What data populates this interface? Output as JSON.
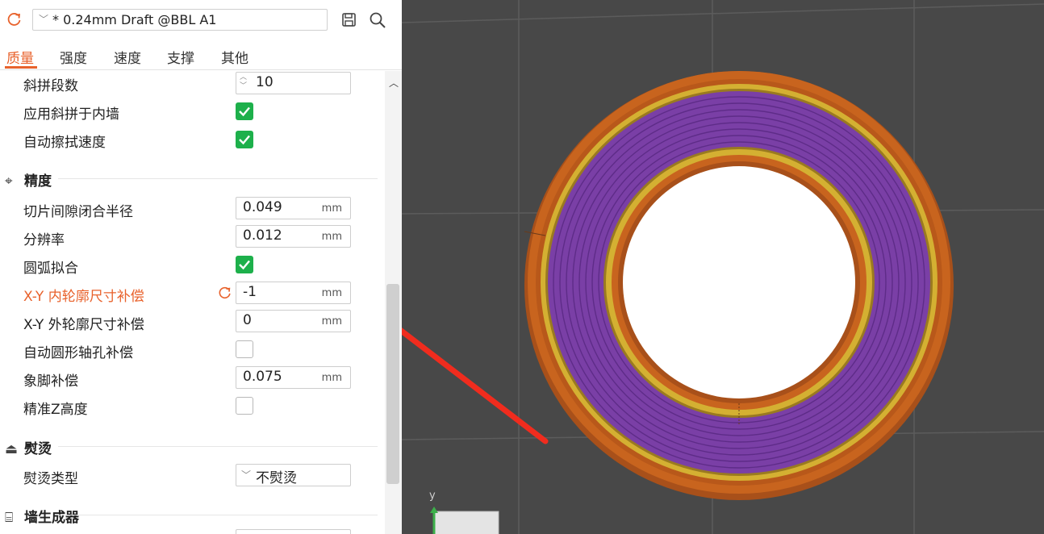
{
  "header": {
    "preset": "* 0.24mm Draft @BBL A1",
    "icons": {
      "reset": "reset-icon",
      "save": "save-icon",
      "search": "search-icon"
    }
  },
  "tabs": [
    "质量",
    "强度",
    "速度",
    "支撑",
    "其他"
  ],
  "rows_top": [
    {
      "label": "斜拼段数",
      "type": "spin",
      "value": "10"
    },
    {
      "label": "应用斜拼于内墙",
      "type": "checkbox",
      "checked": true
    },
    {
      "label": "自动擦拭速度",
      "type": "checkbox",
      "checked": true
    }
  ],
  "section_precision": {
    "title": "精度",
    "rows": [
      {
        "label": "切片间隙闭合半径",
        "value": "0.049",
        "unit": "mm"
      },
      {
        "label": "分辨率",
        "value": "0.012",
        "unit": "mm"
      },
      {
        "label": "圆弧拟合",
        "checked": true
      },
      {
        "label": "X-Y 内轮廓尺寸补偿",
        "value": "-1",
        "unit": "mm",
        "modified": true
      },
      {
        "label": "X-Y 外轮廓尺寸补偿",
        "value": "0",
        "unit": "mm"
      },
      {
        "label": "自动圆形轴孔补偿",
        "checked": false
      },
      {
        "label": "象脚补偿",
        "value": "0.075",
        "unit": "mm"
      },
      {
        "label": "精准Z高度",
        "checked": false
      }
    ]
  },
  "section_ironing": {
    "title": "熨烫",
    "rows": [
      {
        "label": "熨烫类型",
        "value": "不熨烫"
      }
    ]
  },
  "section_wall": {
    "title": "墙生成器"
  },
  "viewport": {
    "axis_label": "y",
    "colors": {
      "background": "#484848",
      "outer_wall": "#c8641e",
      "inner_wall": "#d4b032",
      "infill": "#7a3fa6",
      "arrow": "#f02c1e"
    }
  }
}
